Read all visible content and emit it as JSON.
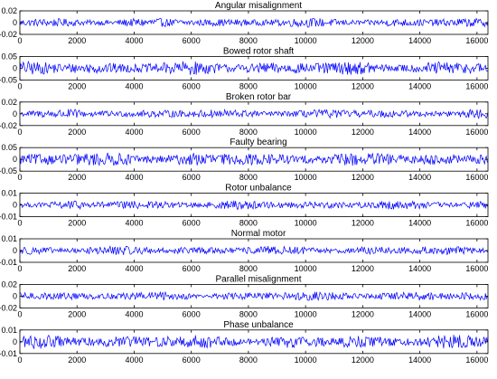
{
  "chart_data": [
    {
      "type": "line",
      "title": "Angular misalignment",
      "xlim": [
        0,
        16384
      ],
      "ylim": [
        -0.02,
        0.02
      ],
      "xticks": [
        "0",
        "2000",
        "4000",
        "6000",
        "8000",
        "10000",
        "12000",
        "14000",
        "16000"
      ],
      "yticks": [
        "-0.02",
        "0",
        "0.02"
      ],
      "series": [
        {
          "color": "#0000ff",
          "amplitude": 0.008,
          "x": [
            0,
            16384
          ]
        }
      ]
    },
    {
      "type": "line",
      "title": "Bowed rotor shaft",
      "xlim": [
        0,
        16384
      ],
      "ylim": [
        -0.05,
        0.05
      ],
      "xticks": [
        "0",
        "2000",
        "4000",
        "6000",
        "8000",
        "10000",
        "12000",
        "14000",
        "16000"
      ],
      "yticks": [
        "-0.05",
        "0",
        "0.05"
      ],
      "series": [
        {
          "color": "#0000ff",
          "amplitude": 0.03,
          "x": [
            0,
            16384
          ]
        }
      ]
    },
    {
      "type": "line",
      "title": "Broken rotor bar",
      "xlim": [
        0,
        16384
      ],
      "ylim": [
        -0.02,
        0.02
      ],
      "xticks": [
        "0",
        "2000",
        "4000",
        "6000",
        "8000",
        "10000",
        "12000",
        "14000",
        "16000"
      ],
      "yticks": [
        "-0.02",
        "0",
        "0.02"
      ],
      "series": [
        {
          "color": "#0000ff",
          "amplitude": 0.008,
          "x": [
            0,
            16384
          ]
        }
      ]
    },
    {
      "type": "line",
      "title": "Faulty bearing",
      "xlim": [
        0,
        16384
      ],
      "ylim": [
        -0.05,
        0.05
      ],
      "xticks": [
        "0",
        "2000",
        "4000",
        "6000",
        "8000",
        "10000",
        "12000",
        "14000",
        "16000"
      ],
      "yticks": [
        "-0.05",
        "0",
        "0.05"
      ],
      "series": [
        {
          "color": "#0000ff",
          "amplitude": 0.03,
          "x": [
            0,
            16384
          ]
        }
      ]
    },
    {
      "type": "line",
      "title": "Rotor unbalance",
      "xlim": [
        0,
        16384
      ],
      "ylim": [
        -0.01,
        0.01
      ],
      "xticks": [
        "0",
        "2000",
        "4000",
        "6000",
        "8000",
        "10000",
        "12000",
        "14000",
        "16000"
      ],
      "yticks": [
        "-0.01",
        "0",
        "0.01"
      ],
      "series": [
        {
          "color": "#0000ff",
          "amplitude": 0.004,
          "x": [
            0,
            16384
          ]
        }
      ]
    },
    {
      "type": "line",
      "title": "Normal motor",
      "xlim": [
        0,
        16384
      ],
      "ylim": [
        -0.01,
        0.01
      ],
      "xticks": [
        "0",
        "2000",
        "4000",
        "6000",
        "8000",
        "10000",
        "12000",
        "14000",
        "16000"
      ],
      "yticks": [
        "-0.01",
        "0",
        "0.01"
      ],
      "series": [
        {
          "color": "#0000ff",
          "amplitude": 0.004,
          "x": [
            0,
            16384
          ]
        }
      ]
    },
    {
      "type": "line",
      "title": "Parallel misalignment",
      "xlim": [
        0,
        16384
      ],
      "ylim": [
        -0.02,
        0.02
      ],
      "xticks": [
        "0",
        "2000",
        "4000",
        "6000",
        "8000",
        "10000",
        "12000",
        "14000",
        "16000"
      ],
      "yticks": [
        "-0.02",
        "0",
        "0.02"
      ],
      "series": [
        {
          "color": "#0000ff",
          "amplitude": 0.008,
          "x": [
            0,
            16384
          ]
        }
      ]
    },
    {
      "type": "line",
      "title": "Phase unbalance",
      "xlim": [
        0,
        16384
      ],
      "ylim": [
        -0.01,
        0.01
      ],
      "xticks": [
        "0",
        "2000",
        "4000",
        "6000",
        "8000",
        "10000",
        "12000",
        "14000",
        "16000"
      ],
      "yticks": [
        "-0.01",
        "0",
        "0.01"
      ],
      "series": [
        {
          "color": "#0000ff",
          "amplitude": 0.006,
          "x": [
            0,
            16384
          ]
        }
      ]
    }
  ]
}
